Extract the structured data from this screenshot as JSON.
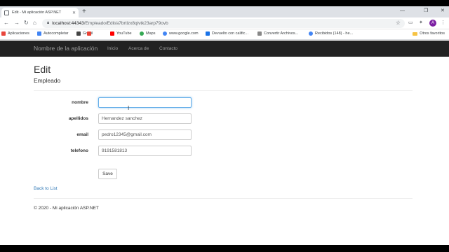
{
  "browser": {
    "tab_title": "Edit - Mi aplicación ASP.NET",
    "url_host": "localhost:44343",
    "url_path": "/Empleado/Edit/a7brtlzx8qivtk23arp79ovb",
    "profile_initial": "A",
    "bookmarks": [
      "Aplicaciones",
      "Autocompletar",
      "Gmail",
      "YouTube",
      "Maps",
      "www.google.com",
      "Devuelto con calific...",
      "Convertir Archivos...",
      "Recibidos (148) - he..."
    ],
    "other_bookmarks": "Otros favoritos",
    "icons": {
      "back": "arrow-left-icon",
      "forward": "arrow-right-icon",
      "reload": "reload-icon",
      "home": "home-icon",
      "star": "star-icon",
      "menu": "three-dots-icon"
    }
  },
  "site": {
    "brand": "Nombre de la aplicación",
    "nav": [
      "Inicio",
      "Acerca de",
      "Contacto"
    ]
  },
  "page": {
    "title": "Edit",
    "subtitle": "Empleado",
    "fields": {
      "nombre": {
        "label": "nombre",
        "value": ""
      },
      "apellidos": {
        "label": "apellidos",
        "value": "Hernandez sanchez"
      },
      "email": {
        "label": "email",
        "value": "pedro12345@gmail.com"
      },
      "telefono": {
        "label": "telefono",
        "value": "9191581813"
      }
    },
    "save_label": "Save",
    "back_link": "Back to List",
    "footer": "© 2020 - Mi aplicación ASP.NET"
  },
  "colors": {
    "navbar": "#222222",
    "nav_text": "#9d9d9d",
    "link": "#337ab7",
    "focus": "#66afe9"
  }
}
